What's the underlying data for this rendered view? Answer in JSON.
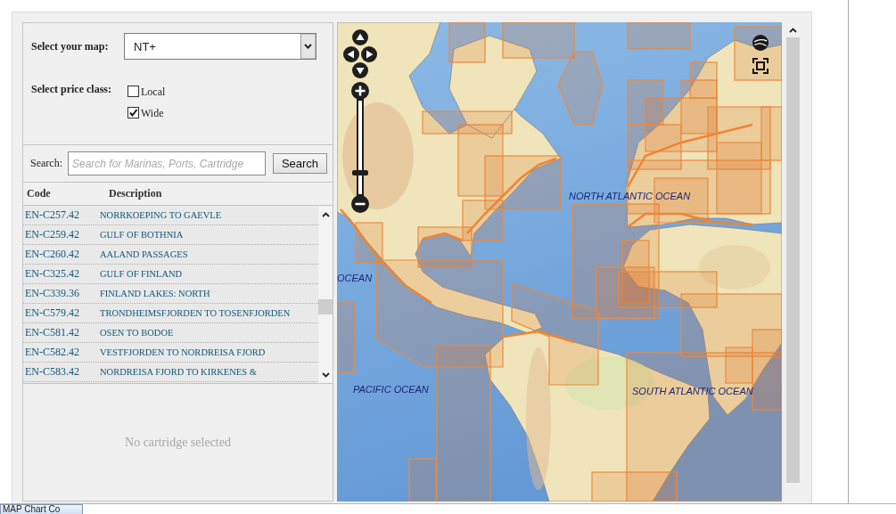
{
  "map_select": {
    "label": "Select your map:",
    "value": "NT+"
  },
  "price_class": {
    "label": "Select price class:",
    "options": [
      {
        "label": "Local",
        "checked": false
      },
      {
        "label": "Wide",
        "checked": true
      }
    ]
  },
  "search": {
    "label": "Search:",
    "placeholder": "Search for Marinas, Ports, Cartridge",
    "button": "Search"
  },
  "table": {
    "columns": [
      "Code",
      "Description"
    ],
    "rows": [
      {
        "code": "EN-C257.42",
        "description": "NORRKOEPING TO GAEVLE"
      },
      {
        "code": "EN-C259.42",
        "description": "GULF OF BOTHNIA"
      },
      {
        "code": "EN-C260.42",
        "description": "AALAND PASSAGES"
      },
      {
        "code": "EN-C325.42",
        "description": "GULF OF FINLAND"
      },
      {
        "code": "EN-C339.36",
        "description": "FINLAND LAKES: NORTH"
      },
      {
        "code": "EN-C579.42",
        "description": "TRONDHEIMSFJORDEN TO TOSENFJORDEN"
      },
      {
        "code": "EN-C581.42",
        "description": "OSEN TO BODOE"
      },
      {
        "code": "EN-C582.42",
        "description": "VESTFJORDEN TO NORDREISA FJORD"
      },
      {
        "code": "EN-C583.42",
        "description": "NORDREISA FJORD TO KIRKENES &"
      }
    ]
  },
  "details": {
    "empty_text": "No cartridge selected"
  },
  "map": {
    "ocean_labels": [
      "NORTH ATLANTIC OCEAN",
      "OCEAN",
      "PACIFIC OCEAN",
      "SOUTH ATLANTIC OCEAN"
    ],
    "zoom": {
      "level": 0.22
    }
  },
  "taskbar": {
    "tabs": [
      {
        "label": "MAP Chart Co"
      }
    ]
  }
}
